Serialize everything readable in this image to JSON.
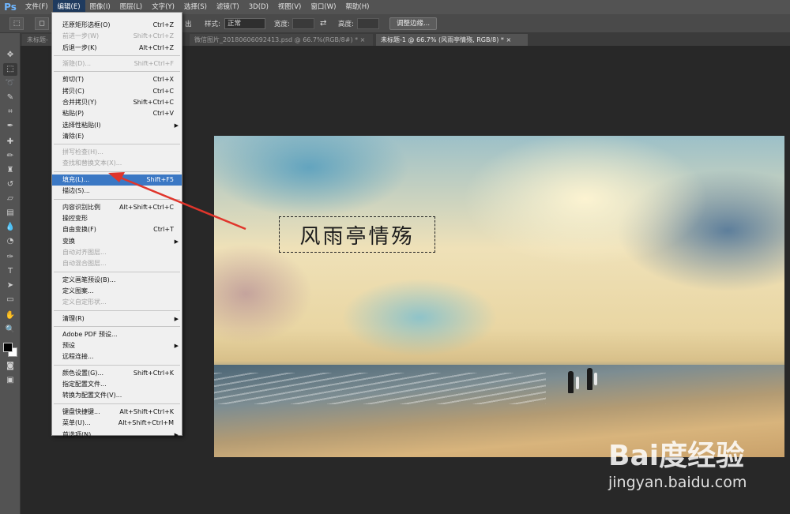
{
  "menubar": {
    "logo": "Ps",
    "items": [
      "文件(F)",
      "编辑(E)",
      "图像(I)",
      "图层(L)",
      "文字(Y)",
      "选择(S)",
      "滤镜(T)",
      "3D(D)",
      "视图(V)",
      "窗口(W)",
      "帮助(H)"
    ]
  },
  "options": {
    "partial_text": "出",
    "style_label": "样式:",
    "style_value": "正常",
    "width_label": "宽度:",
    "height_label": "高度:",
    "refine_button": "调整边缘..."
  },
  "tabs": [
    "未标题-",
    "微信图片_20180606092413.psd @ 66.7%(RGB/8#) * ×",
    "未标题-1 @ 66.7% (风雨亭情殇, RGB/8) * ×"
  ],
  "edit_menu": {
    "items": [
      {
        "label": "还原矩形选框(O)",
        "shortcut": "Ctrl+Z",
        "disabled": false
      },
      {
        "label": "前进一步(W)",
        "shortcut": "Shift+Ctrl+Z",
        "disabled": true
      },
      {
        "label": "后退一步(K)",
        "shortcut": "Alt+Ctrl+Z",
        "disabled": false
      },
      {
        "label": "渐隐(D)...",
        "shortcut": "Shift+Ctrl+F",
        "disabled": true
      },
      {
        "label": "剪切(T)",
        "shortcut": "Ctrl+X",
        "disabled": false
      },
      {
        "label": "拷贝(C)",
        "shortcut": "Ctrl+C",
        "disabled": false
      },
      {
        "label": "合并拷贝(Y)",
        "shortcut": "Shift+Ctrl+C",
        "disabled": false
      },
      {
        "label": "粘贴(P)",
        "shortcut": "Ctrl+V",
        "disabled": false
      },
      {
        "label": "选择性粘贴(I)",
        "shortcut": "",
        "disabled": false
      },
      {
        "label": "清除(E)",
        "shortcut": "",
        "disabled": false
      },
      {
        "label": "拼写检查(H)...",
        "shortcut": "",
        "disabled": true
      },
      {
        "label": "查找和替换文本(X)...",
        "shortcut": "",
        "disabled": true
      },
      {
        "label": "填充(L)...",
        "shortcut": "Shift+F5",
        "disabled": false
      },
      {
        "label": "描边(S)...",
        "shortcut": "",
        "disabled": false
      },
      {
        "label": "内容识别比例",
        "shortcut": "Alt+Shift+Ctrl+C",
        "disabled": false
      },
      {
        "label": "操控变形",
        "shortcut": "",
        "disabled": false
      },
      {
        "label": "自由变换(F)",
        "shortcut": "Ctrl+T",
        "disabled": false
      },
      {
        "label": "变换",
        "shortcut": "",
        "disabled": false
      },
      {
        "label": "自动对齐图层...",
        "shortcut": "",
        "disabled": true
      },
      {
        "label": "自动混合图层...",
        "shortcut": "",
        "disabled": true
      },
      {
        "label": "定义画笔预设(B)...",
        "shortcut": "",
        "disabled": false
      },
      {
        "label": "定义图案...",
        "shortcut": "",
        "disabled": false
      },
      {
        "label": "定义自定形状...",
        "shortcut": "",
        "disabled": true
      },
      {
        "label": "清理(R)",
        "shortcut": "",
        "disabled": false
      },
      {
        "label": "Adobe PDF 预设...",
        "shortcut": "",
        "disabled": false
      },
      {
        "label": "预设",
        "shortcut": "",
        "disabled": false
      },
      {
        "label": "远程连接...",
        "shortcut": "",
        "disabled": false
      },
      {
        "label": "颜色设置(G)...",
        "shortcut": "Shift+Ctrl+K",
        "disabled": false
      },
      {
        "label": "指定配置文件...",
        "shortcut": "",
        "disabled": false
      },
      {
        "label": "转换为配置文件(V)...",
        "shortcut": "",
        "disabled": false
      },
      {
        "label": "键盘快捷键...",
        "shortcut": "Alt+Shift+Ctrl+K",
        "disabled": false
      },
      {
        "label": "菜单(U)...",
        "shortcut": "Alt+Shift+Ctrl+M",
        "disabled": false
      },
      {
        "label": "首选项(N)",
        "shortcut": "",
        "disabled": false
      }
    ],
    "highlighted": "填充(L)..."
  },
  "canvas": {
    "text_layer": "风雨亭情殇"
  },
  "watermark": {
    "logo": "Bai度经验",
    "url": "jingyan.baidu.com"
  },
  "colors": {
    "accent": "#3b78c4",
    "annotation_arrow": "#e0352b"
  }
}
